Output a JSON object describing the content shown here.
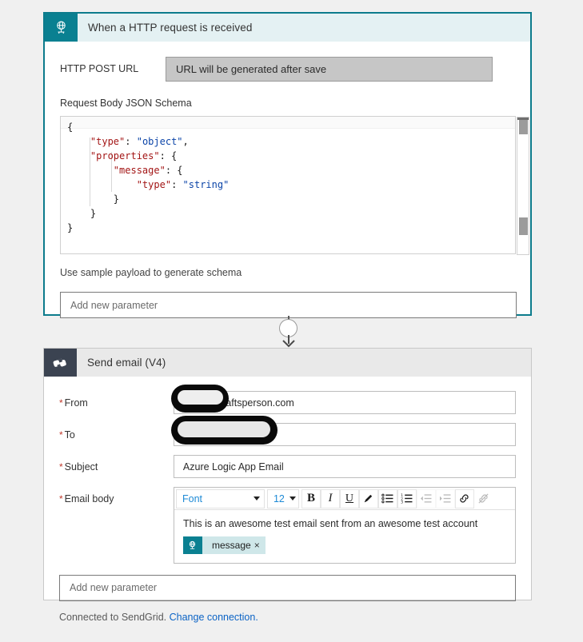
{
  "trigger_card": {
    "icon": "globe-network-icon",
    "title": "When a HTTP request is received",
    "post_url_label": "HTTP POST URL",
    "post_url_value": "URL will be generated after save",
    "schema_label": "Request Body JSON Schema",
    "schema_lines": [
      {
        "indent": 0,
        "parts": [
          {
            "t": "{",
            "c": "p"
          }
        ]
      },
      {
        "indent": 1,
        "parts": [
          {
            "t": "\"type\"",
            "c": "k"
          },
          {
            "t": ": ",
            "c": "p"
          },
          {
            "t": "\"object\"",
            "c": "v"
          },
          {
            "t": ",",
            "c": "p"
          }
        ]
      },
      {
        "indent": 1,
        "parts": [
          {
            "t": "\"properties\"",
            "c": "k"
          },
          {
            "t": ": {",
            "c": "p"
          }
        ]
      },
      {
        "indent": 2,
        "parts": [
          {
            "t": "\"message\"",
            "c": "k"
          },
          {
            "t": ": {",
            "c": "p"
          }
        ]
      },
      {
        "indent": 3,
        "parts": [
          {
            "t": "\"type\"",
            "c": "k"
          },
          {
            "t": ": ",
            "c": "p"
          },
          {
            "t": "\"string\"",
            "c": "v"
          }
        ]
      },
      {
        "indent": 2,
        "parts": [
          {
            "t": "}",
            "c": "p"
          }
        ]
      },
      {
        "indent": 1,
        "parts": [
          {
            "t": "}",
            "c": "p"
          }
        ]
      },
      {
        "indent": 0,
        "parts": [
          {
            "t": "}",
            "c": "p"
          }
        ]
      }
    ],
    "schema_text": "{\n    \"type\": \"object\",\n    \"properties\": {\n        \"message\": {\n            \"type\": \"string\"\n        }\n    }\n}",
    "sample_payload_label": "Use sample payload to generate schema",
    "add_parameter_placeholder": "Add new parameter"
  },
  "connector": {
    "icon": "down-arrow-icon"
  },
  "action_card": {
    "icon": "sendgrid-icon",
    "title": "Send email (V4)",
    "fields": {
      "from_label": "From",
      "from_value": "oftwarecraftsperson.com",
      "to_label": "To",
      "to_value": "",
      "subject_label": "Subject",
      "subject_value": "Azure Logic App Email",
      "body_label": "Email body"
    },
    "toolbar": {
      "font_label": "Font",
      "size_label": "12",
      "bold_label": "B",
      "italic_label": "I",
      "underline_label": "U",
      "highlight_icon": "pen-highlight-icon",
      "bullet_list_icon": "bullet-list-icon",
      "numbered_list_icon": "numbered-list-icon",
      "indent_decrease_icon": "indent-decrease-icon",
      "indent_increase_icon": "indent-increase-icon",
      "link_icon": "link-icon",
      "unlink_icon": "unlink-icon"
    },
    "body_text": "This is an awesome test email sent from an awesome test account",
    "token": {
      "icon": "globe-network-icon",
      "label": "message",
      "remove": "×"
    },
    "add_parameter_placeholder": "Add new parameter",
    "connection_text": "Connected to SendGrid.",
    "connection_link": "Change connection."
  },
  "colors": {
    "trigger_accent": "#0a8091",
    "trigger_border": "#0c7b8c",
    "trigger_header_bg": "#e4f1f3",
    "sendgrid_bg": "#3b4351",
    "action_header_bg": "#e9e9e9",
    "page_bg": "#f0f0f0",
    "required_star": "#c0392b",
    "link": "#0b63c5",
    "json_key": "#a31515",
    "json_value": "#0b44a8",
    "token_bg": "#cfe7e9"
  }
}
